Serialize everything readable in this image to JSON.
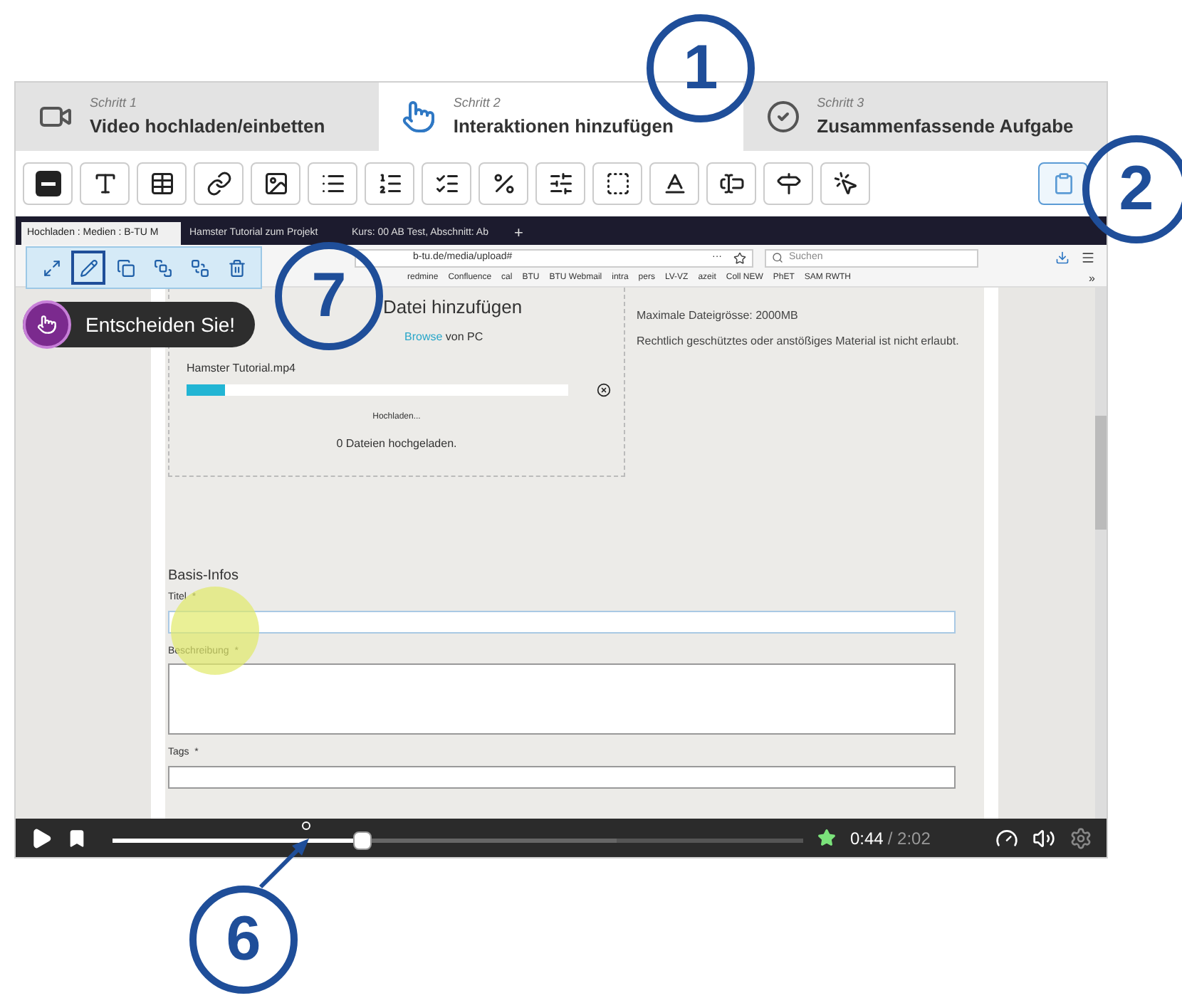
{
  "steps": [
    {
      "label": "Schritt 1",
      "title": "Video hochladen/einbetten",
      "kind": "video",
      "selected": false
    },
    {
      "label": "Schritt 2",
      "title": "Interaktionen hinzufügen",
      "kind": "touch",
      "selected": true
    },
    {
      "label": "Schritt 3",
      "title": "Zusammenfassende Aufgabe",
      "kind": "check",
      "selected": false
    }
  ],
  "toolbar": {
    "buttons": [
      {
        "kind": "label"
      },
      {
        "kind": "text"
      },
      {
        "kind": "table"
      },
      {
        "kind": "link"
      },
      {
        "kind": "image"
      },
      {
        "kind": "list"
      },
      {
        "kind": "radio"
      },
      {
        "kind": "checklist"
      },
      {
        "kind": "fraction"
      },
      {
        "kind": "drag"
      },
      {
        "kind": "dropzone"
      },
      {
        "kind": "mark"
      },
      {
        "kind": "blank"
      },
      {
        "kind": "crossroads"
      },
      {
        "kind": "hotspot"
      }
    ],
    "paste": {
      "selected": true
    }
  },
  "video": {
    "browser": {
      "tabs": [
        {
          "title": "Hochladen : Medien : B-TU M",
          "selected": true
        },
        {
          "title": "Hamster Tutorial zum Projekt",
          "selected": false
        },
        {
          "title": "Kurs: 00 AB Test, Abschnitt: Ab",
          "selected": false
        }
      ],
      "new_tab": "+",
      "address": "b-tu.de/media/upload#",
      "more": "···",
      "search_placeholder": "Suchen",
      "overflow": "»",
      "bookmarks": [
        "redmine",
        "Confluence",
        "cal",
        "BTU",
        "BTU Webmail",
        "intra",
        "pers",
        "LV-VZ",
        "azeit",
        "Coll NEW",
        "PhET",
        "SAM RWTH"
      ]
    },
    "upload": {
      "heading": "Datei hinzufügen",
      "browse_link": "Browse",
      "browse_rest": "von PC",
      "file_name": "Hamster Tutorial.mp4",
      "progress": {
        "level": 0.1
      },
      "status": "Hochladen...",
      "count": "0 Dateien hochgeladen."
    },
    "info": {
      "max_size": "Maximale Dateigrösse: 2000MB",
      "notice": "Rechtlich geschütztes oder anstößiges Material ist nicht erlaubt."
    },
    "form": {
      "heading": "Basis-Infos",
      "fields": [
        {
          "label": "Titel",
          "required": "*",
          "kind": "input"
        },
        {
          "label": "Beschreibung",
          "required": "*",
          "kind": "textarea"
        },
        {
          "label": "Tags",
          "required": "*",
          "kind": "input"
        }
      ]
    },
    "player": {
      "seek": {
        "level": 0.36
      },
      "buffer": {
        "level": 0.73
      },
      "current": "0:44",
      "total": "/ 2:02"
    }
  },
  "interaction_toolbar": {
    "buttons": [
      {
        "kind": "expand",
        "selected": false
      },
      {
        "kind": "edit",
        "selected": true
      },
      {
        "kind": "copy",
        "selected": false
      },
      {
        "kind": "front",
        "selected": false
      },
      {
        "kind": "back",
        "selected": false
      },
      {
        "kind": "delete",
        "selected": false
      }
    ]
  },
  "interaction": {
    "label": "Entscheiden Sie!"
  },
  "callouts": [
    {
      "number": "1",
      "kind": "top"
    },
    {
      "number": "2",
      "kind": "right"
    },
    {
      "number": "7",
      "kind": "middle"
    },
    {
      "number": "6",
      "kind": "bottom"
    }
  ]
}
